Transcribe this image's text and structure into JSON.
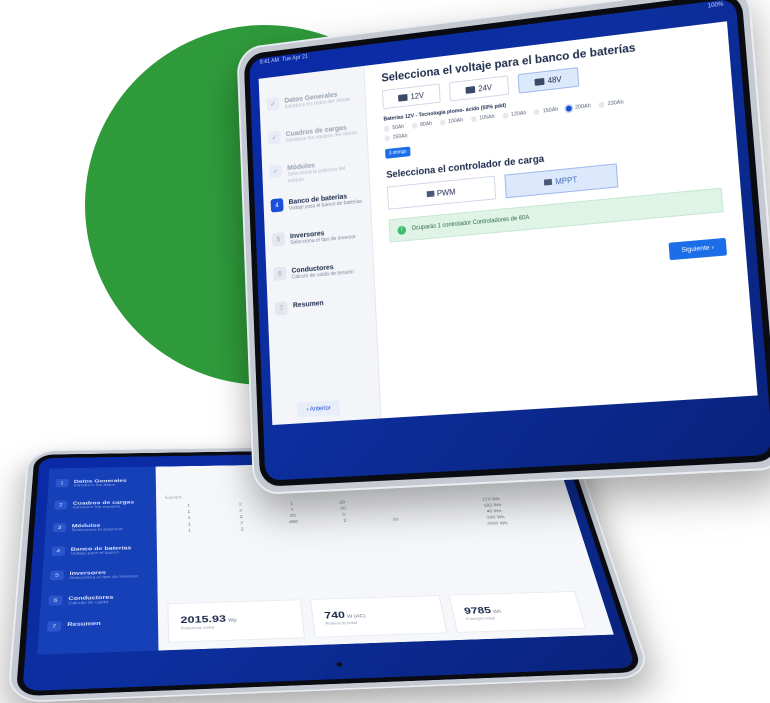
{
  "front": {
    "status": {
      "time": "9:41 AM",
      "date": "Tue Apr 21",
      "battery": "100%"
    },
    "steps": [
      {
        "num": "✓",
        "title": "Datos Generales",
        "desc": "Introduce los datos del cliente",
        "state": "done"
      },
      {
        "num": "✓",
        "title": "Cuadros de cargas",
        "desc": "Introduce los equipos del cliente",
        "state": "done"
      },
      {
        "num": "✓",
        "title": "Módulos",
        "desc": "Selecciona la potencia del módulo",
        "state": "done"
      },
      {
        "num": "4",
        "title": "Banco de baterías",
        "desc": "Voltaje para el banco de baterías",
        "state": "active"
      },
      {
        "num": "5",
        "title": "Inversores",
        "desc": "Selecciona el tipo de inversor",
        "state": "next"
      },
      {
        "num": "6",
        "title": "Conductores",
        "desc": "Cálculo de caída de tensión",
        "state": "next"
      },
      {
        "num": "7",
        "title": "Resumen",
        "desc": "",
        "state": "next"
      }
    ],
    "voltage_title": "Selecciona el voltaje para el banco de baterías",
    "voltages": [
      {
        "label": "12V",
        "selected": false
      },
      {
        "label": "24V",
        "selected": false
      },
      {
        "label": "48V",
        "selected": true
      }
    ],
    "battery_label": "Baterías 12V - Tecnología plomo- ácido (50% pdd)",
    "capacities": [
      {
        "label": "50Ah",
        "selected": false
      },
      {
        "label": "80Ah",
        "selected": false
      },
      {
        "label": "100Ah",
        "selected": false
      },
      {
        "label": "105Ah",
        "selected": false
      },
      {
        "label": "120Ah",
        "selected": false
      },
      {
        "label": "150Ah",
        "selected": false
      },
      {
        "label": "200Ah",
        "selected": true
      },
      {
        "label": "230Ah",
        "selected": false
      },
      {
        "label": "250Ah",
        "selected": false
      }
    ],
    "strings_pill": "3 strings",
    "controller_title": "Selecciona el controlador de carga",
    "controllers": [
      {
        "label": "PWM",
        "selected": false
      },
      {
        "label": "MPPT",
        "selected": true
      }
    ],
    "alert_text": "Ocuparás 1 controlador Controladores de 60A",
    "next_label": "Siguiente",
    "prev_label": "Anterior"
  },
  "back": {
    "steps": [
      {
        "num": "1",
        "title": "Datos Generales",
        "desc": "Introduce los datos"
      },
      {
        "num": "2",
        "title": "Cuadros de cargas",
        "desc": "Introduce los equipos"
      },
      {
        "num": "3",
        "title": "Módulos",
        "desc": "Selecciona la potencia"
      },
      {
        "num": "4",
        "title": "Banco de baterías",
        "desc": "Voltaje para el banco"
      },
      {
        "num": "5",
        "title": "Inversores",
        "desc": "Selecciona el tipo de inversor"
      },
      {
        "num": "6",
        "title": "Conductores",
        "desc": "Cálculo de caída"
      },
      {
        "num": "7",
        "title": "Resumen",
        "desc": ""
      }
    ],
    "energy_header": "Energía total",
    "table_header": "Equipo",
    "grid": [
      "1",
      "2",
      "1",
      "20",
      "",
      "",
      "270 Wh",
      "",
      "1",
      "2",
      "1",
      "20",
      "",
      "",
      "182 Wh",
      "",
      "1",
      "2",
      "20",
      "5",
      "",
      "",
      "40 Wh",
      "",
      "1",
      "2",
      "450",
      "2",
      "20",
      "",
      "280 Wh",
      "",
      "1",
      "2",
      "",
      "",
      "",
      "",
      "2000 Wh",
      ""
    ],
    "stats": [
      {
        "value": "2015.93",
        "unit": "Wp",
        "label": "Potencia solar"
      },
      {
        "value": "740",
        "unit": "W (AC)",
        "label": "Potencia total"
      },
      {
        "value": "9785",
        "unit": "Wh",
        "label": "Energía total"
      }
    ]
  }
}
